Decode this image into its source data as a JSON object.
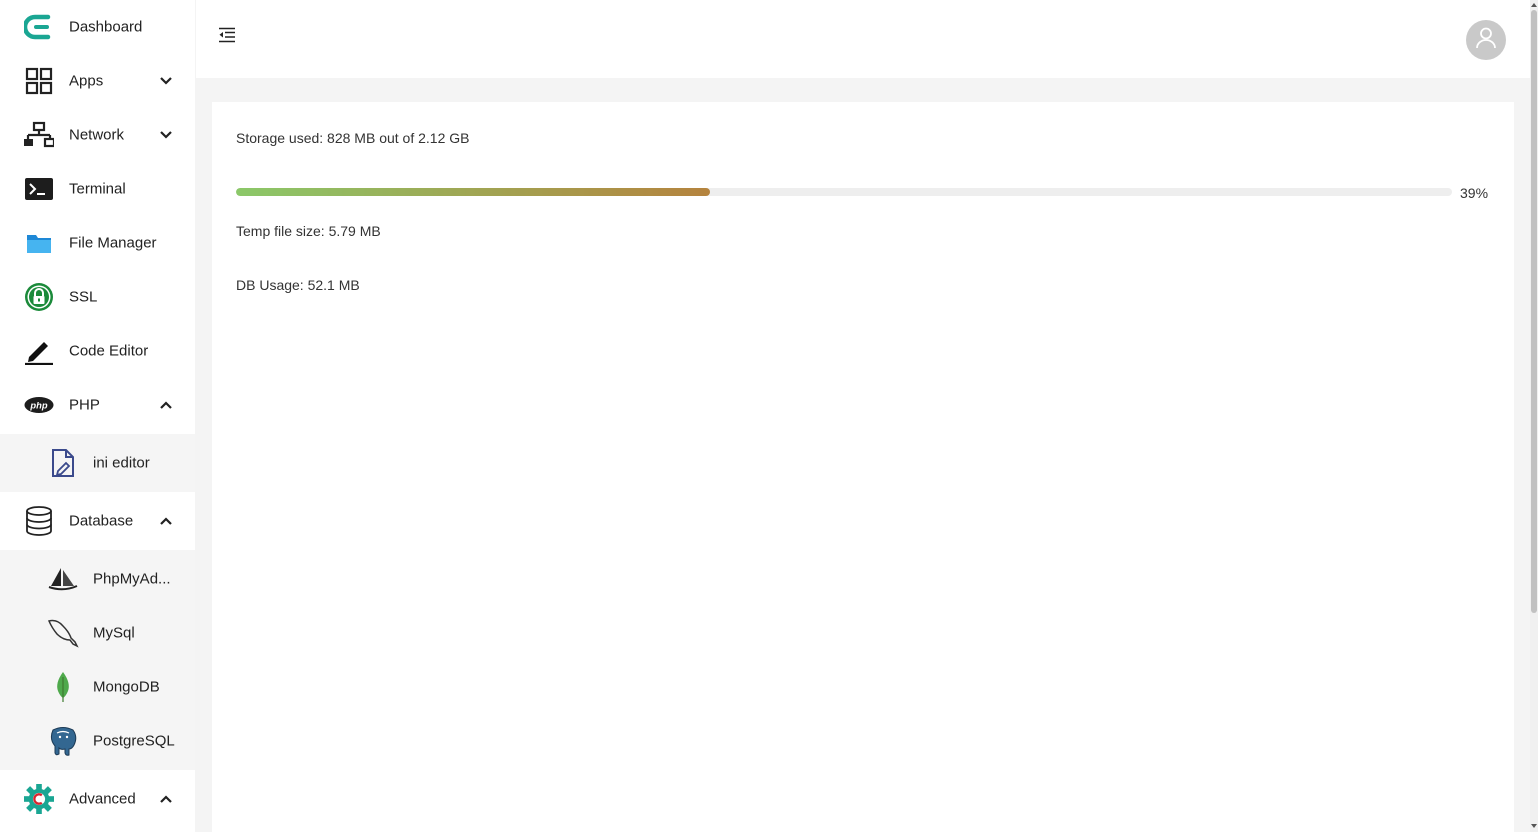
{
  "sidebar": {
    "items": [
      {
        "key": "dashboard",
        "label": "Dashboard",
        "icon": "brand-logo-icon"
      },
      {
        "key": "apps",
        "label": "Apps",
        "icon": "grid-icon",
        "chevron": "down"
      },
      {
        "key": "network",
        "label": "Network",
        "icon": "network-icon",
        "chevron": "down"
      },
      {
        "key": "terminal",
        "label": "Terminal",
        "icon": "terminal-icon"
      },
      {
        "key": "file-manager",
        "label": "File Manager",
        "icon": "folder-icon"
      },
      {
        "key": "ssl",
        "label": "SSL",
        "icon": "lock-icon"
      },
      {
        "key": "code-editor",
        "label": "Code Editor",
        "icon": "pen-icon"
      },
      {
        "key": "php",
        "label": "PHP",
        "icon": "php-icon",
        "chevron": "up"
      },
      {
        "key": "database",
        "label": "Database",
        "icon": "database-icon",
        "chevron": "up"
      },
      {
        "key": "advanced",
        "label": "Advanced",
        "icon": "gear-icon",
        "chevron": "up"
      }
    ],
    "php_sub": [
      {
        "key": "ini-editor",
        "label": "ini editor",
        "icon": "file-edit-icon"
      }
    ],
    "database_sub": [
      {
        "key": "phpmyadmin",
        "label": "PhpMyAd...",
        "icon": "phpmyadmin-icon"
      },
      {
        "key": "mysql",
        "label": "MySql",
        "icon": "mysql-dolphin-icon"
      },
      {
        "key": "mongodb",
        "label": "MongoDB",
        "icon": "mongodb-leaf-icon"
      },
      {
        "key": "postgresql",
        "label": "PostgreSQL",
        "icon": "postgresql-elephant-icon"
      }
    ]
  },
  "header": {
    "menu_toggle_icon": "menu-collapse-icon",
    "avatar_icon": "user-icon"
  },
  "main": {
    "storage_text": "Storage used: 828 MB out of 2.12 GB",
    "progress_percent": 39,
    "progress_label": "39%",
    "temp_text": "Temp file size: 5.79 MB",
    "db_text": "DB Usage: 52.1 MB"
  },
  "colors": {
    "brand": "#1aa693",
    "progress_start": "#8bc869",
    "progress_end": "#b5833e",
    "avatar_bg": "#c9c9c9"
  }
}
